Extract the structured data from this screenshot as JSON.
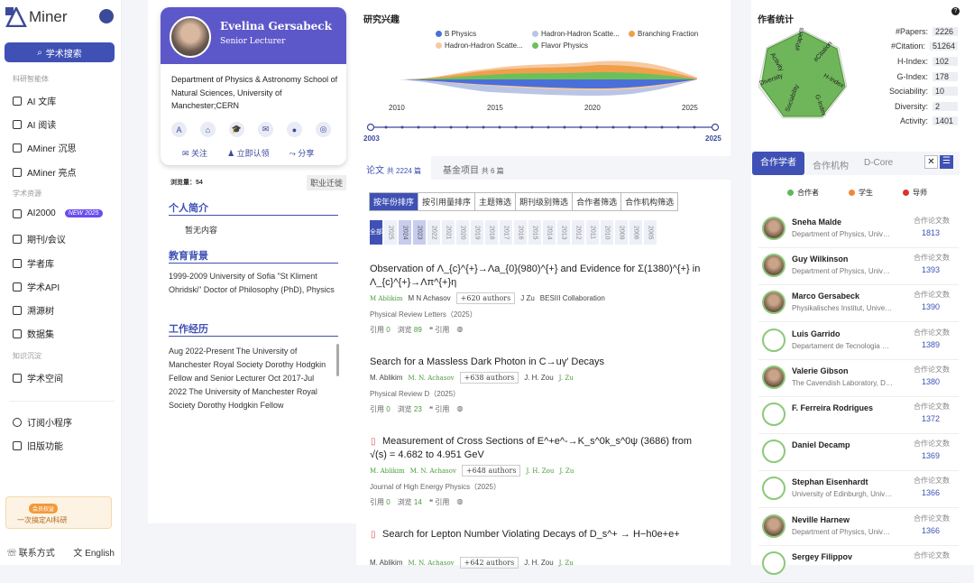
{
  "sidebar": {
    "logo_text": "Miner",
    "search_label": "学术搜索",
    "sections": [
      "科研智能体",
      "学术资源",
      "知识沉淀"
    ],
    "items": [
      {
        "label": "AI 文库"
      },
      {
        "label": "AI 阅读"
      },
      {
        "label": "AMiner 沉思"
      },
      {
        "label": "AMiner 亮点"
      },
      {
        "label": "AI2000",
        "badge": "NEW 2025"
      },
      {
        "label": "期刊/会议"
      },
      {
        "label": "学者库"
      },
      {
        "label": "学术API"
      },
      {
        "label": "溯源树"
      },
      {
        "label": "数据集"
      },
      {
        "label": "学术空间"
      },
      {
        "label": "订阅小程序"
      },
      {
        "label": "旧版功能"
      }
    ],
    "promo_tag": "会员权益",
    "promo_text": "一次搞定AI科研",
    "contact": "联系方式",
    "language": "English"
  },
  "profile": {
    "name": "Evelina Gersabeck",
    "title": "Senior Lecturer",
    "affiliation": "Department of Physics & Astronomy School of Natural Sciences, University of Manchester;CERN",
    "actions": [
      "关注",
      "立即认领",
      "分享"
    ],
    "views_label": "浏览量：54",
    "job_tag": "职业迁徙",
    "intro_title": "个人简介",
    "intro_body": "暂无内容",
    "edu_title": "教育背景",
    "edu_body": "1999-2009 University of Sofia \"St Kliment Ohridski\" Doctor of Philosophy (PhD), Physics",
    "work_title": "工作经历",
    "work_body": "Aug 2022-Present The University of Manchester Royal Society Dorothy Hodgkin Fellow and Senior Lecturer Oct 2017-Jul 2022 The University of Manchester Royal Society Dorothy Hodgkin Fellow"
  },
  "research": {
    "title": "研究兴趣",
    "legend": [
      {
        "name": "B Physics",
        "color": "#4a6fd8"
      },
      {
        "name": "Hadron-Hadron Scatte...",
        "color": "#b9c5e6"
      },
      {
        "name": "Branching Fraction",
        "color": "#f0a04b"
      },
      {
        "name": "Hadron-Hadron Scatte...",
        "color": "#f7c9a0"
      },
      {
        "name": "Flavor Physics",
        "color": "#6cc05a"
      }
    ],
    "axis_years": [
      "2010",
      "2015",
      "2020",
      "2025"
    ],
    "range_start": "2003",
    "range_end": "2025"
  },
  "papers_tabs": {
    "papers": "论文",
    "papers_count": "共 2224 篇",
    "grants": "基金项目",
    "grants_count": "共 6 篇"
  },
  "filters": [
    "按年份排序",
    "按引用量排序",
    "主题筛选",
    "期刊级别筛选",
    "合作者筛选",
    "合作机构筛选"
  ],
  "years": [
    "全部",
    "2025",
    "2024",
    "2023",
    "2022",
    "2021",
    "2020",
    "2019",
    "2018",
    "2017",
    "2016",
    "2015",
    "2014",
    "2013",
    "2012",
    "2011",
    "2010",
    "2009",
    "2006",
    "2005"
  ],
  "papers": [
    {
      "title": "Observation of Λ_{c}^{+}→Λa_{0}(980)^{+} and Evidence for Σ(1380)^{+} in Λ_{c}^{+}→Λπ^{+}η",
      "a1": "M Ablikim",
      "a2": "M N Achasov",
      "more": "+620 authors",
      "a3": "J Zu",
      "a4": "BESIII Collaboration",
      "venue": "Physical Review Letters（2025）",
      "cite_label": "引用",
      "cite": "0",
      "view_label": "浏览",
      "views": "89",
      "ref_label": "引用"
    },
    {
      "title": "Search for a Massless Dark Photon in C→uγ′ Decays",
      "a1": "M. Ablikim",
      "a2": "M. N. Achasov",
      "more": "+638 authors",
      "a3": "J. H. Zou",
      "a4": "J. Zu",
      "venue": "Physical Review D（2025）",
      "cite_label": "引用",
      "cite": "0",
      "view_label": "浏览",
      "views": "23",
      "ref_label": "引用"
    },
    {
      "title": "Measurement of Cross Sections of E^+e^-→K_s^0k_s^0ψ (3686) from √(s) = 4.682 to 4.951 GeV",
      "a1": "M. Ablikim",
      "a2": "M. N. Achasov",
      "more": "+648 authors",
      "a3": "J. H. Zou",
      "a4": "J. Zu",
      "venue": "Journal of High Energy Physics（2025）",
      "cite_label": "引用",
      "cite": "0",
      "view_label": "浏览",
      "views": "14",
      "ref_label": "引用"
    },
    {
      "title": "Search for Lepton Number Violating Decays of D_s^+ → H−h0e+e+",
      "a1": "M. Ablikim",
      "a2": "M. N. Achasov",
      "more": "+642 authors",
      "a3": "J. H. Zou",
      "a4": "J. Zu"
    }
  ],
  "stats": {
    "title": "作者统计",
    "radar_labels": [
      "#Papers",
      "#Citation",
      "H-Index",
      "G-Index",
      "Sociability",
      "Diversity",
      "Activity"
    ],
    "rows": [
      {
        "label": "#Papers:",
        "value": "2226"
      },
      {
        "label": "#Citation:",
        "value": "51264"
      },
      {
        "label": "H-Index:",
        "value": "102"
      },
      {
        "label": "G-Index:",
        "value": "178"
      },
      {
        "label": "Sociability:",
        "value": "10"
      },
      {
        "label": "Diversity:",
        "value": "2"
      },
      {
        "label": "Activity:",
        "value": "1401"
      }
    ]
  },
  "coauthor_tabs": [
    "合作学者",
    "合作机构",
    "D-Core"
  ],
  "coauthor_legend": [
    {
      "name": "合作者",
      "color": "#5cb85c"
    },
    {
      "name": "学生",
      "color": "#f0883a"
    },
    {
      "name": "导师",
      "color": "#d9342b"
    }
  ],
  "coauthors": [
    {
      "name": "Sneha Malde",
      "aff": "Department of Physics, University of Oxford",
      "label": "合作论文数",
      "count": "1813",
      "photo": true
    },
    {
      "name": "Guy Wilkinson",
      "aff": "Department of Physics, University of Oxford",
      "label": "合作论文数",
      "count": "1393",
      "photo": true
    },
    {
      "name": "Marco Gersabeck",
      "aff": "Physikalisches Institut, Universität Freiburg",
      "label": "合作论文数",
      "count": "1390",
      "photo": true
    },
    {
      "name": "Luis Garrido",
      "aff": "Departament de Tecnologia Passiva",
      "label": "合作论文数",
      "count": "1389",
      "photo": false
    },
    {
      "name": "Valerie Gibson",
      "aff": "The Cavendish Laboratory, Department",
      "label": "合作论文数",
      "count": "1380",
      "photo": true
    },
    {
      "name": "F. Ferreira Rodrigues",
      "aff": "",
      "label": "合作论文数",
      "count": "1372",
      "photo": false
    },
    {
      "name": "Daniel Decamp",
      "aff": "",
      "label": "合作论文数",
      "count": "1369",
      "photo": false
    },
    {
      "name": "Stephan Eisenhardt",
      "aff": "University of Edinburgh, University",
      "label": "合作论文数",
      "count": "1366",
      "photo": false
    },
    {
      "name": "Neville Harnew",
      "aff": "Department of Physics, University of Oxford",
      "label": "合作论文数",
      "count": "1366",
      "photo": true
    },
    {
      "name": "Sergey Filippov",
      "aff": "",
      "label": "合作论文数",
      "count": "",
      "photo": false
    }
  ]
}
